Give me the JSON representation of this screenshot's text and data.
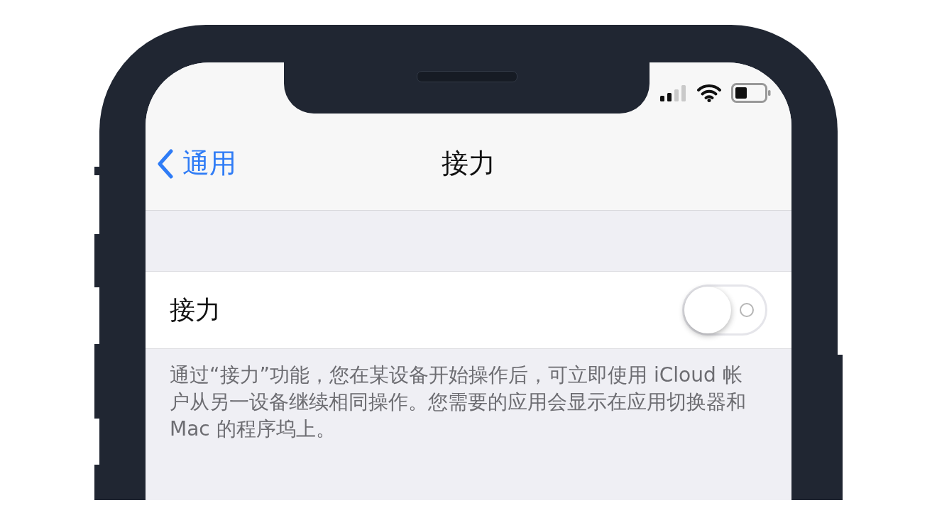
{
  "nav": {
    "back_label": "通用",
    "title": "接力"
  },
  "setting": {
    "label": "接力",
    "on": false
  },
  "footer": "通过“接力”功能，您在某设备开始操作后，可立即使用 iCloud 帐户从另一设备继续相同操作。您需要的应用会显示在应用切换器和 Mac 的程序坞上。"
}
